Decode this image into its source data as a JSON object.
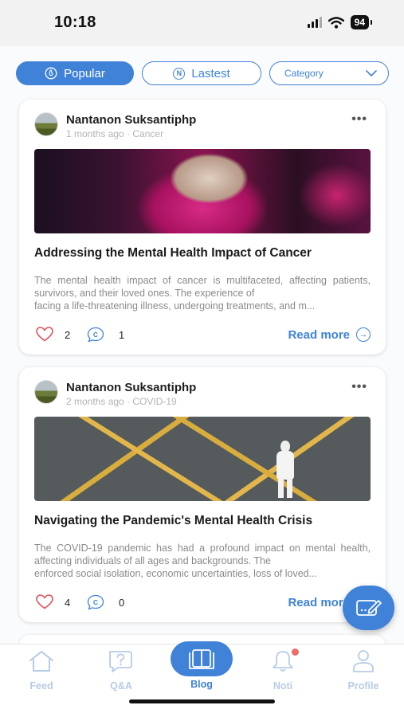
{
  "status_bar": {
    "time": "10:18",
    "battery": "94"
  },
  "filters": {
    "popular": {
      "label": "Popular",
      "icon": "flame-circle-icon"
    },
    "latest": {
      "label": "Lastest",
      "icon_letter": "N"
    },
    "category": {
      "label": "Category"
    }
  },
  "posts": [
    {
      "author": "Nantanon Suksantiphp",
      "meta": "1 months ago · Cancer",
      "title": "Addressing the Mental Health Impact of Cancer",
      "excerpt_main": "The mental health impact of cancer is multifaceted, affecting patients, survivors, and their loved ones. The experience of",
      "excerpt_last": "facing a life-threatening illness, undergoing treatments, and m...",
      "likes": "2",
      "comments": "1",
      "read_more": "Read more",
      "image": "cancer-support-hug-photo"
    },
    {
      "author": "Nantanon Suksantiphp",
      "meta": "2 months ago · COVID-19",
      "title": "Navigating the Pandemic's Mental Health Crisis",
      "excerpt_main": "The COVID-19 pandemic has had a profound impact on mental health, affecting individuals of all ages and backgrounds. The",
      "excerpt_last": "enforced social isolation, economic uncertainties, loss of loved...",
      "likes": "4",
      "comments": "0",
      "read_more": "Read more",
      "image": "hazmat-suit-street-photo"
    }
  ],
  "bottom_nav": {
    "feed": "Feed",
    "qa": "Q&A",
    "blog": "Blog",
    "noti": "Noti",
    "profile": "Profile",
    "active": "blog"
  },
  "colors": {
    "accent": "#3f82d8",
    "inactive_nav": "#b6cbe6",
    "like": "#e0515a",
    "badge": "#f06b6b"
  }
}
